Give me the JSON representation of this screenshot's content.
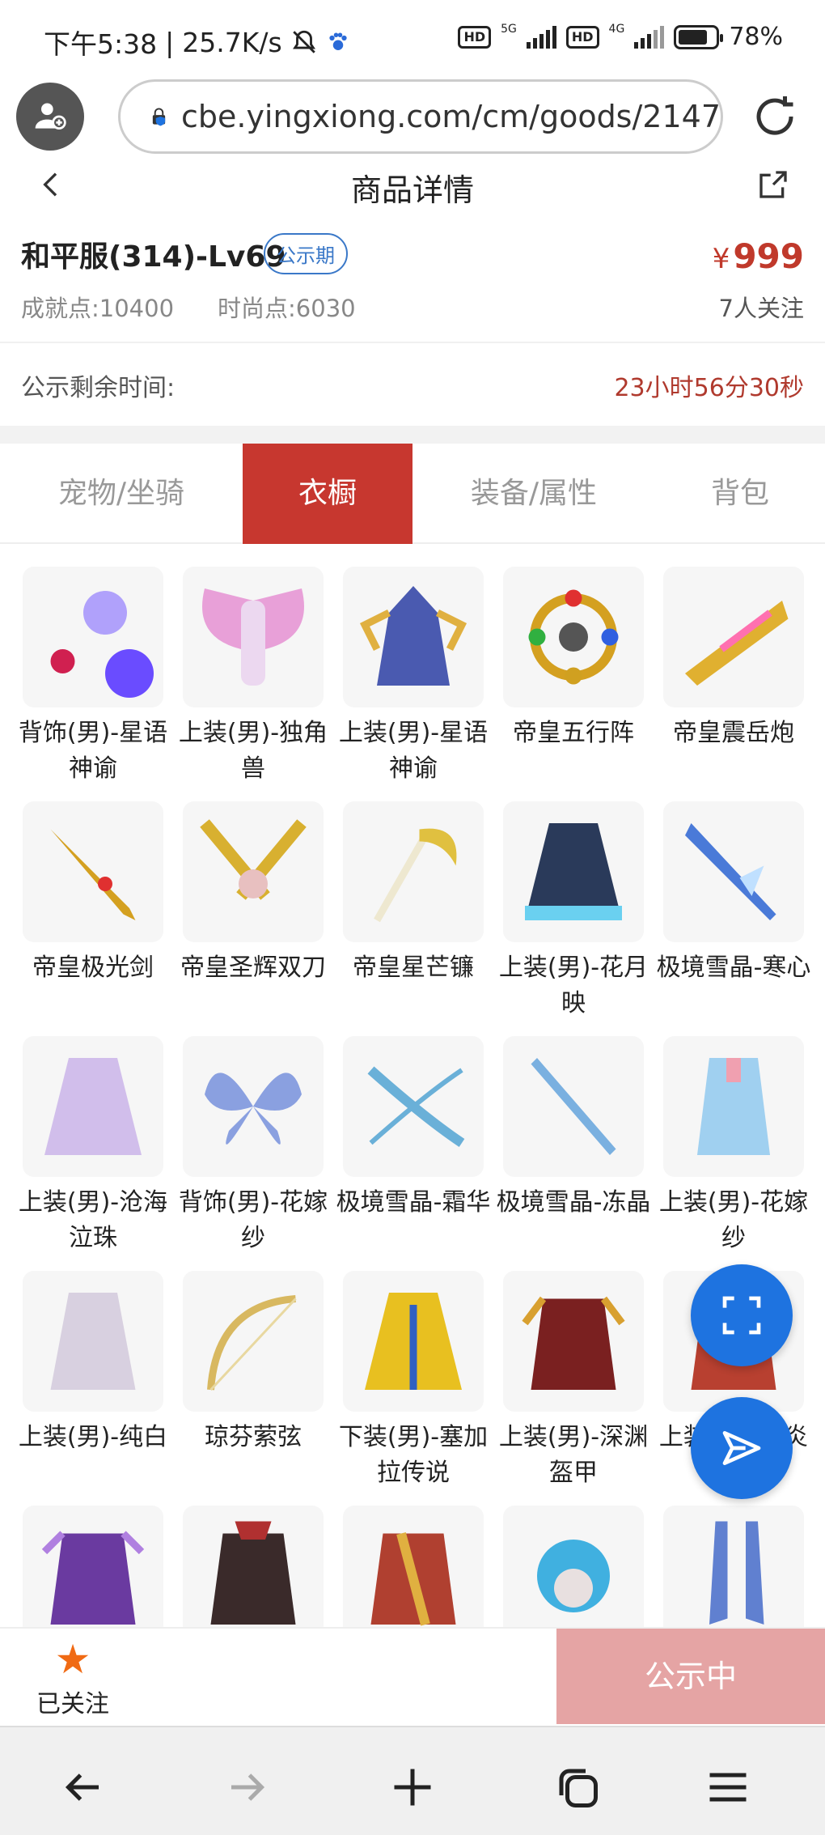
{
  "status_bar": {
    "time": "下午5:38",
    "speed": "25.7K/s",
    "net1": "5G",
    "net2": "4G",
    "hd_label": "HD",
    "battery": "78%",
    "battery_level": 0.78
  },
  "browser": {
    "url": "cbe.yingxiong.com/cm/goods/2147"
  },
  "page": {
    "title": "商品详情"
  },
  "product": {
    "name": "和平服(314)-Lv69",
    "tag": "公示期",
    "currency": "¥",
    "price": "999",
    "achievement": "成就点:10400",
    "fashion": "时尚点:6030",
    "followers": "7人关注"
  },
  "remaining": {
    "label": "公示剩余时间:",
    "time": "23小时56分30秒"
  },
  "tabs": [
    {
      "label": "宠物/坐骑",
      "active": false
    },
    {
      "label": "衣橱",
      "active": true
    },
    {
      "label": "装备/属性",
      "active": false
    },
    {
      "label": "背包",
      "active": false
    }
  ],
  "items": [
    {
      "name": "背饰(男)-星语神谕",
      "icon": "orb-icon",
      "color": "#6a4cff"
    },
    {
      "name": "上装(男)-独角兽",
      "icon": "wings-icon",
      "color": "#e8a0d8"
    },
    {
      "name": "上装(男)-星语神谕",
      "icon": "armor-icon",
      "color": "#4a5ab0"
    },
    {
      "name": "帝皇五行阵",
      "icon": "ring-icon",
      "color": "#d4a020"
    },
    {
      "name": "帝皇震岳炮",
      "icon": "cannon-icon",
      "color": "#e0b030"
    },
    {
      "name": "帝皇极光剑",
      "icon": "sword-icon",
      "color": "#d4a020"
    },
    {
      "name": "帝皇圣辉双刀",
      "icon": "dual-blade-icon",
      "color": "#d8b030"
    },
    {
      "name": "帝皇星芒镰",
      "icon": "scythe-icon",
      "color": "#e0c040"
    },
    {
      "name": "上装(男)-花月映",
      "icon": "coat-icon",
      "color": "#2a3a5a"
    },
    {
      "name": "极境雪晶-寒心",
      "icon": "ice-sword-icon",
      "color": "#4a7ad8"
    },
    {
      "name": "上装(男)-沧海泣珠",
      "icon": "robe-icon",
      "color": "#c8b0e8"
    },
    {
      "name": "背饰(男)-花嫁纱",
      "icon": "fairy-wings-icon",
      "color": "#8aa0e0"
    },
    {
      "name": "极境雪晶-霜华",
      "icon": "bow-icon",
      "color": "#6ab0d8"
    },
    {
      "name": "极境雪晶-冻晶",
      "icon": "ice-spear-icon",
      "color": "#7ab0e0"
    },
    {
      "name": "上装(男)-花嫁纱",
      "icon": "suit-icon",
      "color": "#a0d0f0"
    },
    {
      "name": "上装(男)-纯白",
      "icon": "white-coat-icon",
      "color": "#d8d0e0"
    },
    {
      "name": "琼芬萦弦",
      "icon": "golden-bow-icon",
      "color": "#d8b860"
    },
    {
      "name": "下装(男)-塞加拉传说",
      "icon": "cape-icon",
      "color": "#e8c020"
    },
    {
      "name": "上装(男)-深渊盔甲",
      "icon": "dark-armor-icon",
      "color": "#7a2020"
    },
    {
      "name": "上装(男)-赤炎",
      "icon": "red-coat-icon",
      "color": "#b84030"
    },
    {
      "name": "",
      "icon": "purple-armor-icon",
      "color": "#6a3aa0"
    },
    {
      "name": "",
      "icon": "pirate-coat-icon",
      "color": "#3a2a2a"
    },
    {
      "name": "",
      "icon": "red-jacket-icon",
      "color": "#b04030"
    },
    {
      "name": "",
      "icon": "blue-hair-icon",
      "color": "#40b0e0"
    },
    {
      "name": "",
      "icon": "boots-icon",
      "color": "#6080d0"
    }
  ],
  "bottom": {
    "follow_label": "已关注",
    "status_button": "公示中"
  },
  "colors": {
    "accent": "#c7372f",
    "price": "#c0392b",
    "fab": "#1e73e0",
    "follow_star": "#f06a14"
  }
}
